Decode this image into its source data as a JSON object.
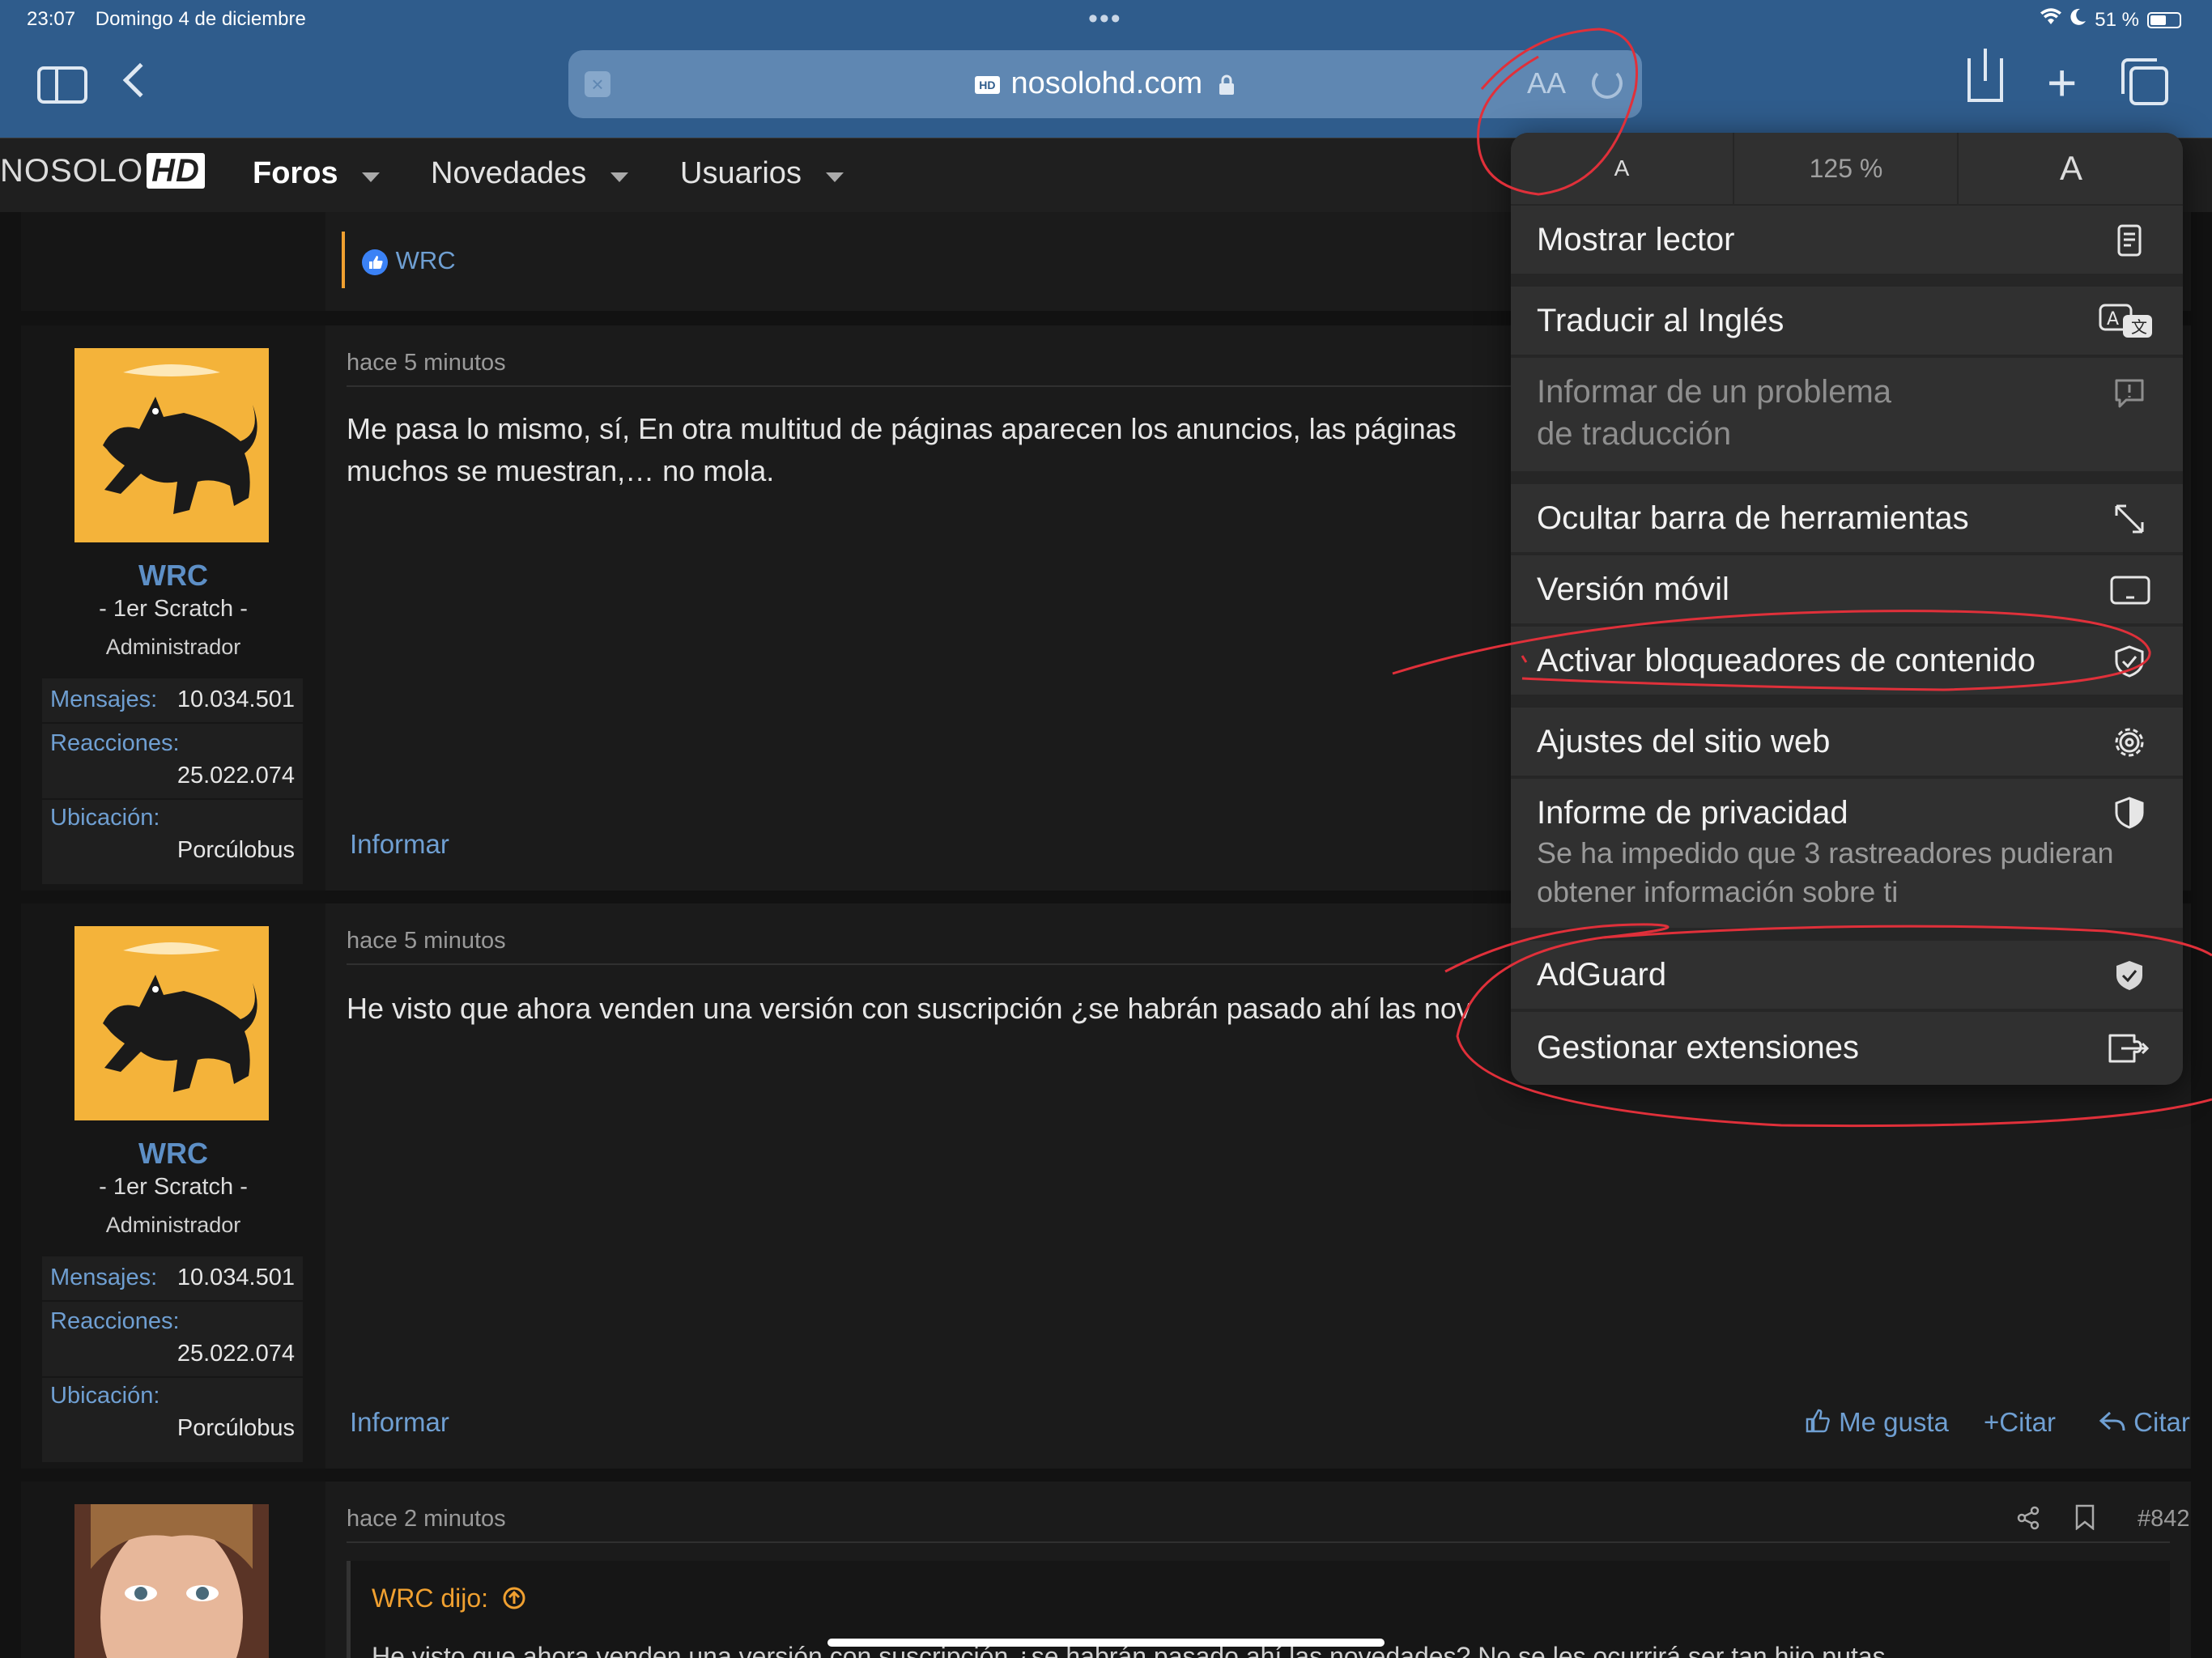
{
  "status": {
    "time": "23:07",
    "date": "Domingo 4 de diciembre",
    "battery": "51 %"
  },
  "toolbar": {
    "url": "nosolohd.com",
    "site_badge": "HD",
    "aa": "AA"
  },
  "nav": {
    "logo_text": "NOSOLO",
    "logo_hd": "HD",
    "items": [
      "Foros",
      "Novedades",
      "Usuarios"
    ]
  },
  "top_post": {
    "reaction_user": "WRC"
  },
  "posts": [
    {
      "time": "hace 5 minutos",
      "text_lines": [
        "Me pasa lo mismo, sí, En otra multitud de páginas aparecen los anuncios, las páginas",
        "muchos se muestran,… no mola."
      ],
      "user": "WRC",
      "title": "- 1er Scratch -",
      "role": "Administrador",
      "stats": [
        {
          "label": "Mensajes:",
          "value": "10.034.501"
        },
        {
          "label": "Reacciones:",
          "value": "25.022.074"
        },
        {
          "label": "Ubicación:",
          "value": "Porcúlobus"
        }
      ],
      "report": "Informar"
    },
    {
      "time": "hace 5 minutos",
      "text_lines": [
        "He visto que ahora venden una versión con suscripción ¿se habrán pasado ahí las nov"
      ],
      "user": "WRC",
      "title": "- 1er Scratch -",
      "role": "Administrador",
      "stats": [
        {
          "label": "Mensajes:",
          "value": "10.034.501"
        },
        {
          "label": "Reacciones:",
          "value": "25.022.074"
        },
        {
          "label": "Ubicación:",
          "value": "Porcúlobus"
        }
      ],
      "report": "Informar",
      "actions": [
        "Me gusta",
        "Citar",
        "Citar"
      ]
    },
    {
      "time": "hace 2 minutos",
      "number": "#842",
      "quote_author": "WRC dijo:",
      "quote_text": "He visto que ahora venden una versión con suscripción ¿se habrán pasado ahí las novedades? No se les ocurrirá ser tan hijo putas"
    }
  ],
  "menu": {
    "zoom": {
      "small": "A",
      "level": "125 %",
      "large": "A"
    },
    "items": [
      {
        "label": "Mostrar lector",
        "icon": "reader-icon"
      },
      {
        "label": "Traducir al Inglés",
        "icon": "translate-icon"
      },
      {
        "label": "Informar de un problema",
        "label2": "de traducción",
        "icon": "report-bubble-icon"
      },
      {
        "label": "Ocultar barra de herramientas",
        "icon": "expand-arrows-icon"
      },
      {
        "label": "Versión móvil",
        "icon": "mobile-version-icon"
      },
      {
        "label": "Activar bloqueadores de contenido",
        "icon": "shield-check-icon"
      },
      {
        "label": "Ajustes del sitio web",
        "icon": "gear-icon"
      },
      {
        "label": "Informe de privacidad",
        "sub1": "Se ha impedido que 3 rastreadores pudieran",
        "sub2": "obtener información sobre ti",
        "icon": "privacy-shield-icon"
      },
      {
        "label": "AdGuard",
        "icon": "adguard-shield-icon"
      },
      {
        "label": "Gestionar extensiones",
        "icon": "extensions-icon"
      }
    ]
  },
  "colors": {
    "toolbar": "#2f5c8c",
    "link": "#6f9fd2",
    "annotation": "#e0303a"
  }
}
